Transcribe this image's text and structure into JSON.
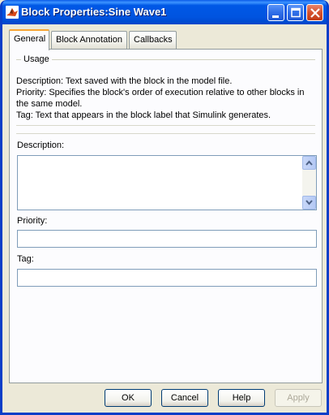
{
  "window": {
    "title": "Block Properties:Sine Wave1"
  },
  "titlebar_buttons": {
    "minimize_icon": "minimize-icon",
    "maximize_icon": "maximize-icon",
    "close_icon": "close-icon"
  },
  "tabs": [
    {
      "label": "General",
      "active": true
    },
    {
      "label": "Block Annotation",
      "active": false
    },
    {
      "label": "Callbacks",
      "active": false
    }
  ],
  "usage": {
    "legend": "Usage",
    "lines": [
      "Description: Text saved with the block in the model file.",
      "Priority: Specifies the block's order of execution relative to other blocks in",
      "the same model.",
      "Tag: Text that appears in the block label that Simulink generates."
    ]
  },
  "fields": {
    "description_label": "Description:",
    "description_value": "",
    "priority_label": "Priority:",
    "priority_value": "",
    "tag_label": "Tag:",
    "tag_value": ""
  },
  "buttons": {
    "ok": "OK",
    "cancel": "Cancel",
    "help": "Help",
    "apply": "Apply"
  },
  "colors": {
    "titlebar": "#0054e3",
    "tab_active_accent": "#f7a432",
    "dialog_bg": "#ece9d8"
  }
}
